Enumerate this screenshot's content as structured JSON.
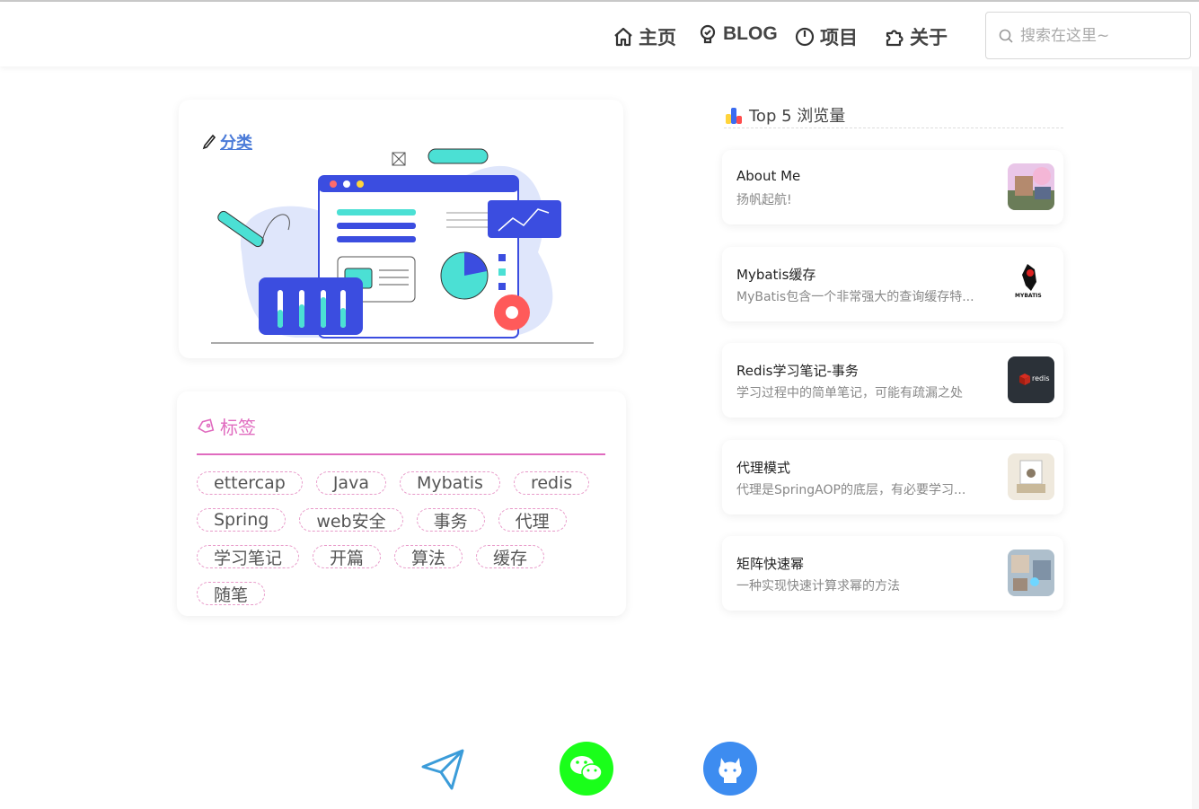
{
  "nav": {
    "home": "主页",
    "blog": "BLOG",
    "projects": "项目",
    "about": "关于"
  },
  "search": {
    "placeholder": "搜索在这里~"
  },
  "category": {
    "title": "分类"
  },
  "tags": {
    "title": "标签",
    "items": [
      "ettercap",
      "Java",
      "Mybatis",
      "redis",
      "Spring",
      "web安全",
      "事务",
      "代理",
      "学习笔记",
      "开篇",
      "算法",
      "缓存",
      "随笔"
    ]
  },
  "top5": {
    "title": "Top 5 浏览量",
    "posts": [
      {
        "title": "About Me",
        "desc": "扬帆起航!"
      },
      {
        "title": "Mybatis缓存",
        "desc": "MyBatis包含一个非常强大的查询缓存特..."
      },
      {
        "title": "Redis学习笔记-事务",
        "desc": "学习过程中的简单笔记，可能有疏漏之处"
      },
      {
        "title": "代理模式",
        "desc": "代理是SpringAOP的底层，有必要学习..."
      },
      {
        "title": "矩阵快速幂",
        "desc": "一种实现快速计算求幂的方法"
      }
    ]
  },
  "thumbs": {
    "mybatis_label": "MYBATIS",
    "redis_label": "redis"
  },
  "colors": {
    "accent_pink": "#e06bbf",
    "accent_blue": "#4b7bd8",
    "wechat_green": "#1aff1a",
    "github_blue": "#3d8cf0"
  }
}
